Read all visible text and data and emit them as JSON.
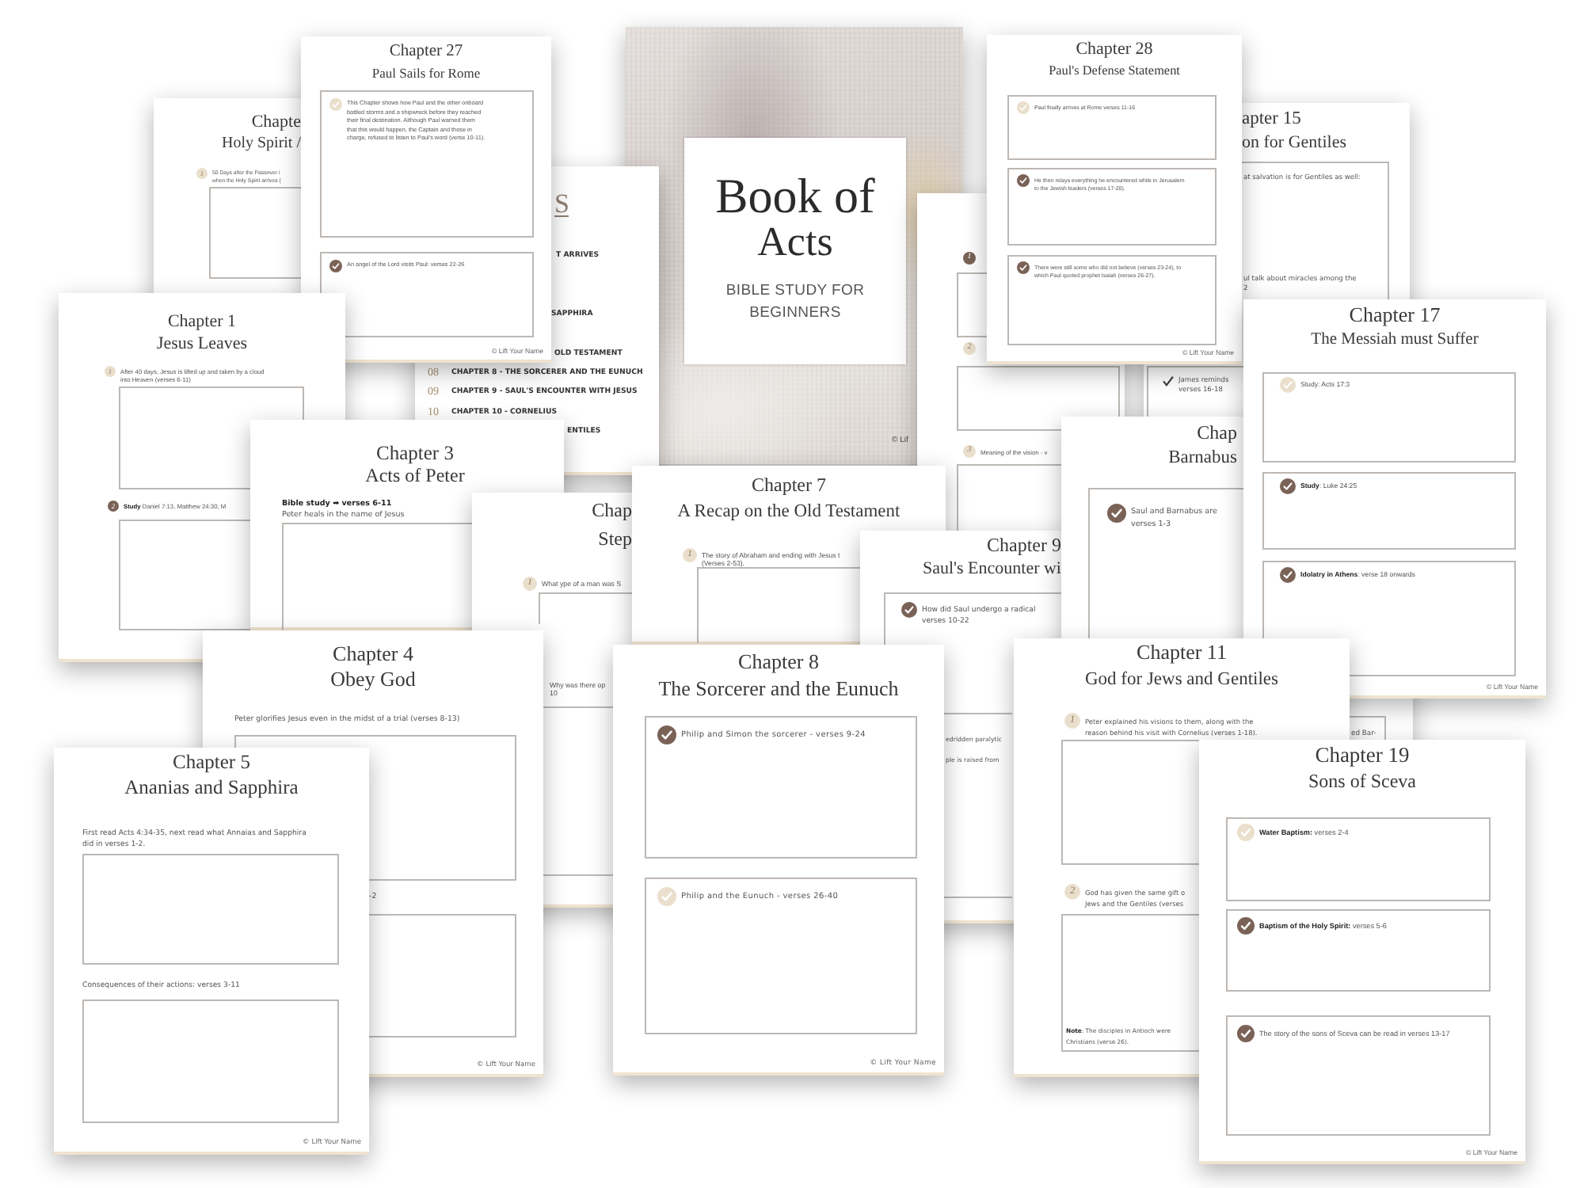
{
  "pages": [
    {
      "kind": "worksheet",
      "chapter": "Chapte",
      "title": "Holy Spirit /",
      "items": [
        {
          "kind": "captioned",
          "marker": {
            "kind": "number",
            "label": "1",
            "filled": false
          },
          "lines": [
            "50 Days after the Passover i",
            "when the Holy Spirit arrives ("
          ]
        }
      ]
    },
    {
      "kind": "worksheet",
      "chapter": "Chapter 27",
      "title": "Paul Sails for Rome",
      "items": [
        {
          "kind": "boxed",
          "marker": {
            "kind": "check",
            "filled": false
          },
          "lines": [
            "This Chapter shows how Paul and the other onboard",
            "battled storms and a shipwreck before they reached",
            "their final destination. Although Paul warned them",
            "that this would happen, the Captain and those in",
            "charge, refused to listen to Paul's word (verse 10-11)."
          ]
        },
        {
          "kind": "boxed",
          "marker": {
            "kind": "check",
            "filled": true
          },
          "lines": [
            "An angel of the Lord visits Paul: verses 22-26"
          ]
        }
      ],
      "footer": "© Lift Your Name"
    },
    {
      "kind": "contents",
      "heading": "S",
      "rows": [
        {
          "label": "T ARRIVES"
        },
        {
          "label": "SAPPHIRA"
        },
        {
          "label": "OLD TESTAMENT"
        },
        {
          "number": "08",
          "label": "CHAPTER 8 - THE SORCERER AND THE EUNUCH"
        },
        {
          "number": "09",
          "label": "CHAPTER 9 - SAUL'S ENCOUNTER WITH JESUS"
        },
        {
          "number": "10",
          "label": "CHAPTER 10 - CORNELIUS"
        },
        {
          "label": "ENTILES"
        }
      ]
    },
    {
      "kind": "cover",
      "title_lines": [
        "Book of",
        "Acts"
      ],
      "subtitle_lines": [
        "BIBLE STUDY FOR",
        "BEGINNERS"
      ],
      "footer": "© Lif"
    },
    {
      "kind": "worksheet",
      "items": [
        {
          "kind": "captioned",
          "marker": {
            "kind": "number",
            "label": "1",
            "filled": true
          }
        },
        {
          "kind": "captioned",
          "marker": {
            "kind": "number",
            "label": "2",
            "filled": false
          }
        },
        {
          "kind": "captioned",
          "marker": {
            "kind": "number",
            "label": "3",
            "filled": false
          },
          "lines": [
            "Meaning of the vision - v"
          ]
        }
      ]
    },
    {
      "kind": "worksheet",
      "chapter": "Chapter 28",
      "title": "Paul's Defense Statement",
      "items": [
        {
          "kind": "boxed",
          "marker": {
            "kind": "check",
            "filled": false
          },
          "lines": [
            "Paul finally arrives at Rome verses 11-16"
          ]
        },
        {
          "kind": "boxed",
          "marker": {
            "kind": "check",
            "filled": true
          },
          "lines": [
            "He then relays everything he encountered while in Jerusalem",
            "to the Jewish leaders (verses 17-20)."
          ]
        },
        {
          "kind": "boxed",
          "marker": {
            "kind": "check",
            "filled": true
          },
          "lines": [
            "There were still some who did not believe (verses 23-24), to",
            "which Paul quoted prophet Isaiah (verses 26-27)."
          ]
        }
      ],
      "footer": "© Lift Your Name"
    },
    {
      "kind": "worksheet",
      "chapter": "apter 15",
      "title": "on for Gentiles",
      "items": [
        {
          "kind": "boxed",
          "lines": [
            "at salvation is for Gentiles as well:"
          ],
          "note_lines": [
            "ul talk about miracles among the",
            "2"
          ]
        },
        {
          "kind": "boxed",
          "marker": {
            "kind": "tick"
          },
          "lines": [
            "James reminds",
            "verses 16-18"
          ]
        }
      ]
    },
    {
      "kind": "worksheet",
      "chapter": "Chapter 1",
      "title": "Jesus Leaves",
      "items": [
        {
          "kind": "captioned",
          "marker": {
            "kind": "number",
            "label": "1",
            "filled": false
          },
          "lines": [
            "After 40 days, Jesus is lifted up and taken by a cloud",
            "into Heaven (verses 6-11)"
          ]
        },
        {
          "kind": "captioned",
          "marker": {
            "kind": "number",
            "label": "2",
            "filled": true
          },
          "lines": [
            "**Study** Daniel 7:13, Matthew 24:30, M"
          ]
        }
      ]
    },
    {
      "kind": "worksheet",
      "chapter": "Chapter 3",
      "title": "Acts of Peter",
      "items": [
        {
          "kind": "plain",
          "lines": [
            "**Bible study ➡ verses 6-11**",
            "Peter heals in the name of Jesus"
          ]
        }
      ]
    },
    {
      "kind": "worksheet",
      "chapter": "Chap",
      "title": "Step",
      "items": [
        {
          "kind": "captioned",
          "marker": {
            "kind": "number",
            "label": "1",
            "filled": false
          },
          "lines": [
            "What ype of a man was S"
          ]
        },
        {
          "kind": "plain",
          "lines": [
            "Why was there op",
            "10"
          ]
        }
      ]
    },
    {
      "kind": "worksheet",
      "chapter": "Chapter 7",
      "title": "A Recap on the Old Testament",
      "items": [
        {
          "kind": "captioned",
          "marker": {
            "kind": "number",
            "label": "1",
            "filled": false
          },
          "lines": [
            "The story of Abraham and ending with Jesus t",
            "(Verses 2-53)."
          ]
        }
      ]
    },
    {
      "kind": "worksheet",
      "chapter": "Chapter 9",
      "title": "Saul's Encounter wi",
      "items": [
        {
          "kind": "boxed",
          "marker": {
            "kind": "check",
            "filled": true
          },
          "lines": [
            "How did Saul undergo a radical",
            "verses 10-22"
          ]
        },
        {
          "kind": "boxed",
          "lines": [
            "edridden paralytic",
            "ple is raised from"
          ]
        }
      ]
    },
    {
      "kind": "worksheet",
      "chapter": "Chap",
      "title": "Barnabus",
      "items": [
        {
          "kind": "boxed",
          "marker": {
            "kind": "check",
            "filled": true
          },
          "lines": [
            "Saul and Barnabus are",
            "verses 1-3"
          ]
        },
        {
          "kind": "boxed",
          "lines": [
            "ed Bar-"
          ]
        }
      ]
    },
    {
      "kind": "worksheet",
      "chapter": "Chapter 17",
      "title": "The Messiah must Suffer",
      "items": [
        {
          "kind": "boxed",
          "marker": {
            "kind": "check",
            "filled": false
          },
          "lines": [
            "Study: Acts 17:3"
          ]
        },
        {
          "kind": "boxed",
          "marker": {
            "kind": "check",
            "filled": true
          },
          "lines": [
            "**Study**: Luke 24:25"
          ]
        },
        {
          "kind": "boxed",
          "marker": {
            "kind": "check",
            "filled": true
          },
          "lines": [
            "**Idolatry in Athens**: verse 18 onwards"
          ]
        }
      ],
      "footer": "© Lift Your Name"
    },
    {
      "kind": "worksheet",
      "chapter": "Chapter 5",
      "title": "Ananias and Sapphira",
      "items": [
        {
          "kind": "plain",
          "lines": [
            "First read Acts 4:34-35, next read what Annaias and Sapphira",
            "did in verses 1-2."
          ]
        },
        {
          "kind": "plain",
          "lines": [
            "Consequences of their actions: verses 3-11"
          ]
        }
      ],
      "footer": "© Lift Your Name"
    },
    {
      "kind": "worksheet",
      "chapter": "Chapter 4",
      "title": "Obey God",
      "items": [
        {
          "kind": "plain",
          "lines": [
            "Peter glorifies Jesus even in the midst of a trial (verses 8-13)"
          ]
        },
        {
          "kind": "plain",
          "lines": [
            "-2"
          ]
        }
      ],
      "footer": "© Lift Your Name"
    },
    {
      "kind": "worksheet",
      "chapter": "Chapter 8",
      "title": "The Sorcerer and the Eunuch",
      "items": [
        {
          "kind": "boxed",
          "marker": {
            "kind": "check",
            "filled": true
          },
          "lines": [
            "Philip and Simon the sorcerer - verses 9-24"
          ]
        },
        {
          "kind": "boxed",
          "marker": {
            "kind": "check",
            "filled": false
          },
          "lines": [
            "Philip and the Eunuch - verses 26-40"
          ]
        }
      ],
      "footer": "© Lift Your Name"
    },
    {
      "kind": "worksheet",
      "chapter": "Chapter 11",
      "title": "God for Jews and Gentiles",
      "items": [
        {
          "kind": "captioned",
          "marker": {
            "kind": "number",
            "label": "1",
            "filled": false
          },
          "lines": [
            "Peter explained his visions to them, along with the",
            "reason behind his visit with Cornelius (verses 1-18)."
          ]
        },
        {
          "kind": "captioned",
          "marker": {
            "kind": "number",
            "label": "2",
            "filled": false
          },
          "lines": [
            "God has given the same gift o",
            "Jews and the Gentiles (verses"
          ],
          "note_lines": [
            "**Note**: The disciples in Antioch were",
            "Christians (verse 26)."
          ]
        }
      ]
    },
    {
      "kind": "worksheet",
      "chapter": "Chapter 19",
      "title": "Sons of Sceva",
      "items": [
        {
          "kind": "boxed",
          "marker": {
            "kind": "check",
            "filled": false
          },
          "lines": [
            "**Water Baptism:** verses 2-4"
          ]
        },
        {
          "kind": "boxed",
          "marker": {
            "kind": "check",
            "filled": true
          },
          "lines": [
            "**Baptism of the Holy Spirit:** verses 5-6"
          ]
        },
        {
          "kind": "boxed",
          "marker": {
            "kind": "check",
            "filled": true
          },
          "lines": [
            "The story of the sons of Sceva can be read in verses 13-17"
          ]
        }
      ],
      "footer": "© Lift Your Name"
    }
  ]
}
